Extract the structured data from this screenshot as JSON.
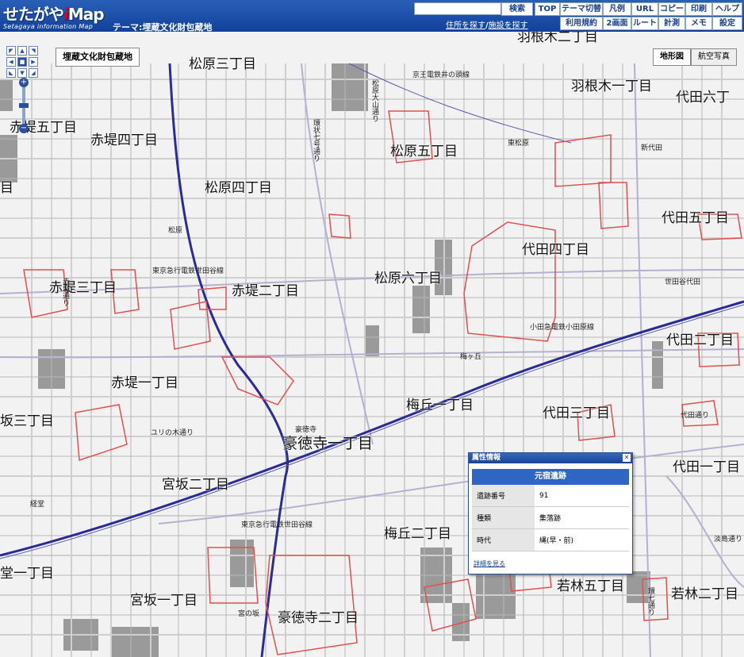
{
  "header": {
    "logo_main": "せたがや",
    "logo_i": "i",
    "logo_map": "Map",
    "logo_sub": "Setagaya information Map",
    "theme_label": "テーマ:埋蔵文化財包蔵地",
    "search_value": "",
    "search_button": "検索",
    "addr_link": "住所を探す",
    "addr_sep": "/",
    "facility_link": "施設を探す",
    "buttons_row1": [
      "TOP",
      "テーマ切替",
      "凡例",
      "URL",
      "コピー",
      "印刷",
      "ヘルプ"
    ],
    "buttons_row2": [
      "利用規約",
      "2画面",
      "ルート",
      "計測",
      "メモ",
      "設定"
    ]
  },
  "map_controls": {
    "zoom_in": "+",
    "zoom_out": "−",
    "theme_button": "埋蔵文化財包蔵地",
    "topo_button": "地形図",
    "aerial_button": "航空写真"
  },
  "places": [
    "松原三丁目",
    "羽根木一丁目",
    "代田六丁",
    "赤堤五丁目",
    "赤堤四丁目",
    "松原五丁目",
    "松原四丁目",
    "代田五丁目",
    "代田四丁目",
    "赤堤三丁目",
    "赤堤二丁目",
    "松原六丁目",
    "代田二丁目",
    "赤堤一丁目",
    "梅丘一丁目",
    "代田三丁目",
    "坂三丁目",
    "豪徳寺一丁目",
    "代田一丁目",
    "宮坂二丁目",
    "梅丘二丁目",
    "若林五丁目",
    "若林二丁目",
    "堂一丁目",
    "宮坂一丁目",
    "豪徳寺二丁目",
    "目",
    "羽根木二丁目"
  ],
  "small_labels": [
    "京王電鉄井の頭線",
    "東松原",
    "新代田",
    "松原",
    "東京急行電鉄世田谷線",
    "世田谷代田",
    "小田急電鉄小田原線",
    "梅ヶ丘",
    "ユリの木通り",
    "豪徳寺",
    "東京急行電鉄世田谷線",
    "宮の坂",
    "淡島通り",
    "経堂",
    "代田通り",
    "松原大山通り",
    "環状七号通り",
    "赤堤通り",
    "環七通り"
  ],
  "popup": {
    "header": "属性情報",
    "title": "元宿遺跡",
    "rows": [
      {
        "key": "遺跡番号",
        "value": "91"
      },
      {
        "key": "種類",
        "value": "集落跡"
      },
      {
        "key": "時代",
        "value": "縄(早・前)"
      }
    ],
    "more_link": "詳細を見る"
  },
  "colors": {
    "header": "#1a4a9e",
    "boundary": "#e05050",
    "rail": "#1a2a9a",
    "road": "#c8c0d8"
  }
}
